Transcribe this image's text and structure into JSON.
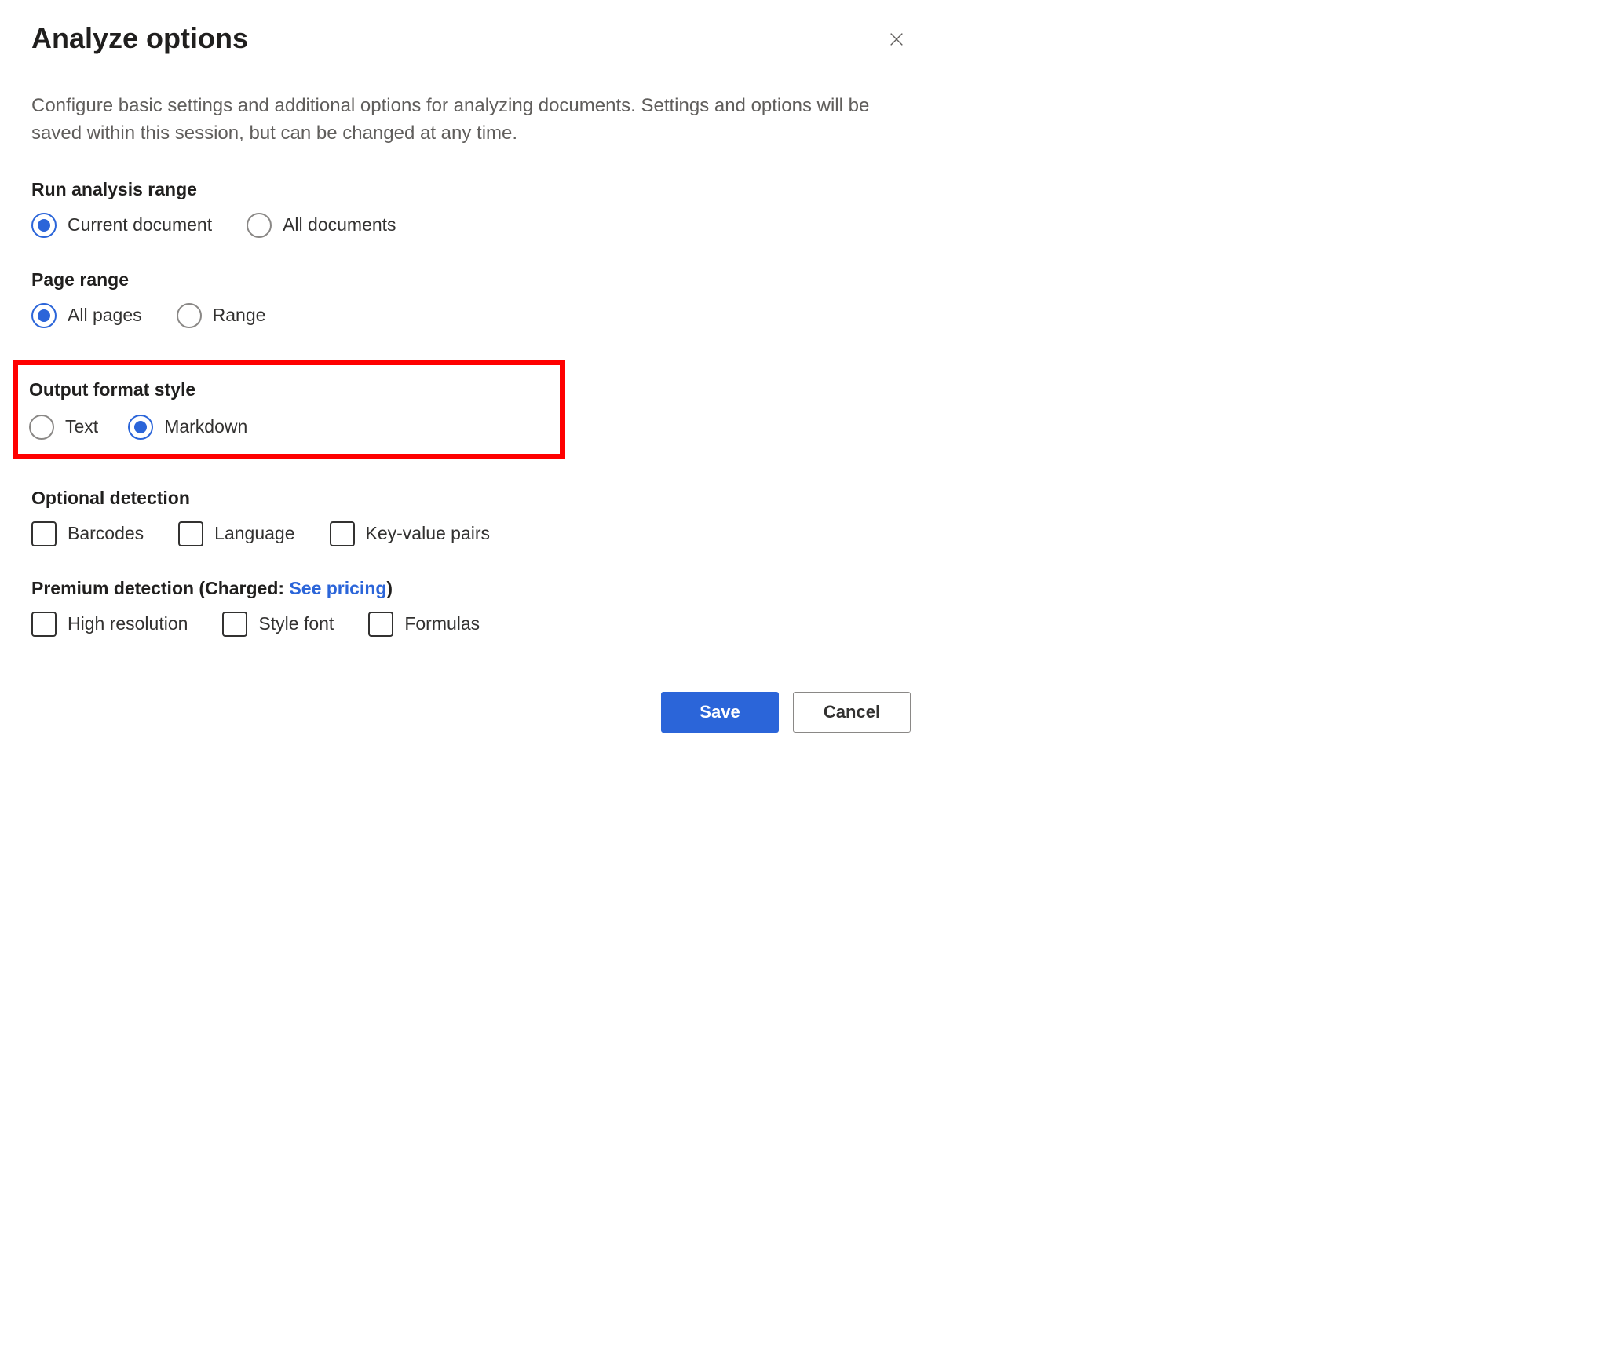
{
  "dialog": {
    "title": "Analyze options",
    "description": "Configure basic settings and additional options for analyzing documents. Settings and options will be saved within this session, but can be changed at any time."
  },
  "sections": {
    "runAnalysis": {
      "title": "Run analysis range",
      "options": {
        "current": {
          "label": "Current document",
          "selected": true
        },
        "all": {
          "label": "All documents",
          "selected": false
        }
      }
    },
    "pageRange": {
      "title": "Page range",
      "options": {
        "allPages": {
          "label": "All pages",
          "selected": true
        },
        "range": {
          "label": "Range",
          "selected": false
        }
      }
    },
    "outputFormat": {
      "title": "Output format style",
      "options": {
        "text": {
          "label": "Text",
          "selected": false
        },
        "markdown": {
          "label": "Markdown",
          "selected": true
        }
      }
    },
    "optionalDetection": {
      "title": "Optional detection",
      "options": {
        "barcodes": {
          "label": "Barcodes",
          "checked": false
        },
        "language": {
          "label": "Language",
          "checked": false
        },
        "kvpairs": {
          "label": "Key-value pairs",
          "checked": false
        }
      }
    },
    "premiumDetection": {
      "titlePrefix": "Premium detection (Charged: ",
      "linkText": "See pricing",
      "titleSuffix": ")",
      "options": {
        "highRes": {
          "label": "High resolution",
          "checked": false
        },
        "styleFont": {
          "label": "Style font",
          "checked": false
        },
        "formulas": {
          "label": "Formulas",
          "checked": false
        }
      }
    }
  },
  "footer": {
    "save": "Save",
    "cancel": "Cancel"
  }
}
